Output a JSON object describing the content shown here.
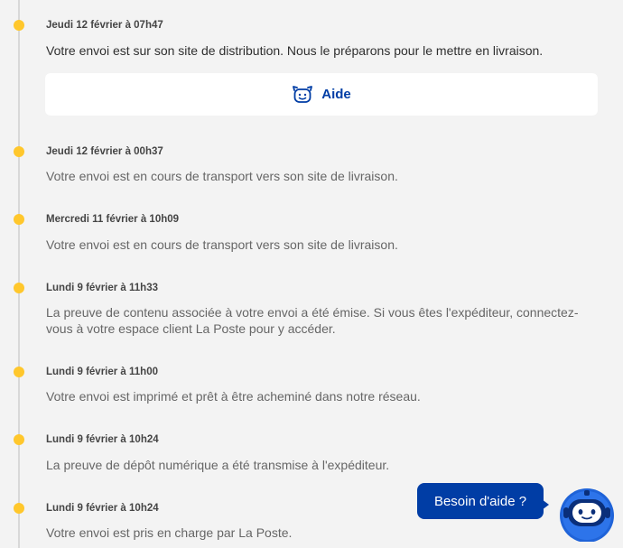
{
  "events": [
    {
      "date": "Jeudi 12 février à 07h47",
      "text": "Votre envoi est sur son site de distribution. Nous le préparons pour le mettre en livraison."
    },
    {
      "date": "Jeudi 12 février à 00h37",
      "text": "Votre envoi est en cours de transport vers son site de livraison."
    },
    {
      "date": "Mercredi 11 février à 10h09",
      "text": "Votre envoi est en cours de transport vers son site de livraison."
    },
    {
      "date": "Lundi 9 février à 11h33",
      "text": "La preuve de contenu associée à votre envoi a été émise. Si vous êtes l'expéditeur, connectez-vous à votre espace client La Poste pour y accéder."
    },
    {
      "date": "Lundi 9 février à 11h00",
      "text": "Votre envoi est imprimé et prêt à être acheminé dans notre réseau."
    },
    {
      "date": "Lundi 9 février à 10h24",
      "text": "La preuve de dépôt numérique a été transmise à l'expéditeur."
    },
    {
      "date": "Lundi 9 février à 10h24",
      "text": "Votre envoi est pris en charge par La Poste."
    }
  ],
  "help_card": {
    "label": "Aide",
    "icon": "smiley-alarm-icon"
  },
  "chat": {
    "bubble_label": "Besoin d'aide ?",
    "icon": "chatbot-icon"
  },
  "colors": {
    "accent_blue": "#003da5",
    "timeline_dot": "#ffc72c",
    "background": "#f3f3f3"
  }
}
